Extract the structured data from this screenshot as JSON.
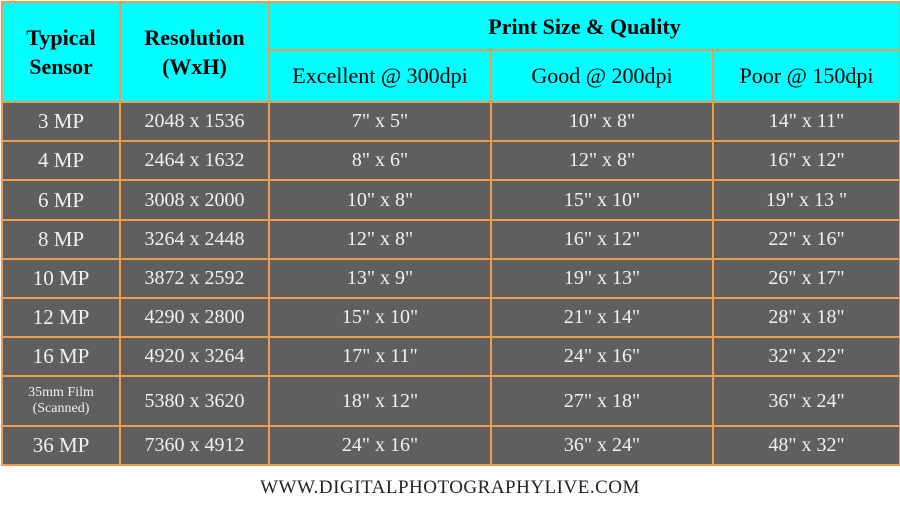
{
  "header": {
    "sensor_label": "Typical Sensor",
    "resolution_label": "Resolution (WxH)",
    "group_label": "Print Size & Quality",
    "quality_columns": [
      "Excellent @ 300dpi",
      "Good @ 200dpi",
      "Poor @ 150dpi"
    ]
  },
  "rows": [
    {
      "sensor": "3 MP",
      "resolution": "2048 x 1536",
      "excellent": "7\" x 5\"",
      "good": "10\" x 8\"",
      "poor": "14\" x 11\""
    },
    {
      "sensor": "4 MP",
      "resolution": "2464 x 1632",
      "excellent": "8\" x 6\"",
      "good": "12\" x 8\"",
      "poor": "16\" x 12\""
    },
    {
      "sensor": "6 MP",
      "resolution": "3008 x 2000",
      "excellent": "10\" x 8\"",
      "good": "15\" x 10\"",
      "poor": "19\" x 13 \""
    },
    {
      "sensor": "8 MP",
      "resolution": "3264 x 2448",
      "excellent": "12\" x 8\"",
      "good": "16\" x 12\"",
      "poor": "22\" x 16\""
    },
    {
      "sensor": "10 MP",
      "resolution": "3872 x 2592",
      "excellent": "13\" x 9\"",
      "good": "19\" x 13\"",
      "poor": "26\" x 17\""
    },
    {
      "sensor": "12 MP",
      "resolution": "4290 x 2800",
      "excellent": "15\" x 10\"",
      "good": "21\" x 14\"",
      "poor": "28\" x 18\""
    },
    {
      "sensor": "16 MP",
      "resolution": "4920 x 3264",
      "excellent": "17\" x 11\"",
      "good": "24\" x 16\"",
      "poor": "32\" x 22\""
    },
    {
      "sensor": "35mm Film (Scanned)",
      "sensor_line1": "35mm Film",
      "sensor_line2": "(Scanned)",
      "resolution": "5380 x 3620",
      "excellent": "18\" x 12\"",
      "good": "27\" x 18\"",
      "poor": "36\" x 24\""
    },
    {
      "sensor": "36 MP",
      "resolution": "7360 x 4912",
      "excellent": "24\" x 16\"",
      "good": "36\" x 24\"",
      "poor": "48\" x 32\""
    }
  ],
  "footer": {
    "website": "WWW.DIGITALPHOTOGRAPHYLIVE.COM"
  },
  "colors": {
    "header_bg": "#00ffff",
    "cell_bg": "#5f5f5f",
    "border": "#f29a4e",
    "cell_text": "#f0f0f0"
  }
}
